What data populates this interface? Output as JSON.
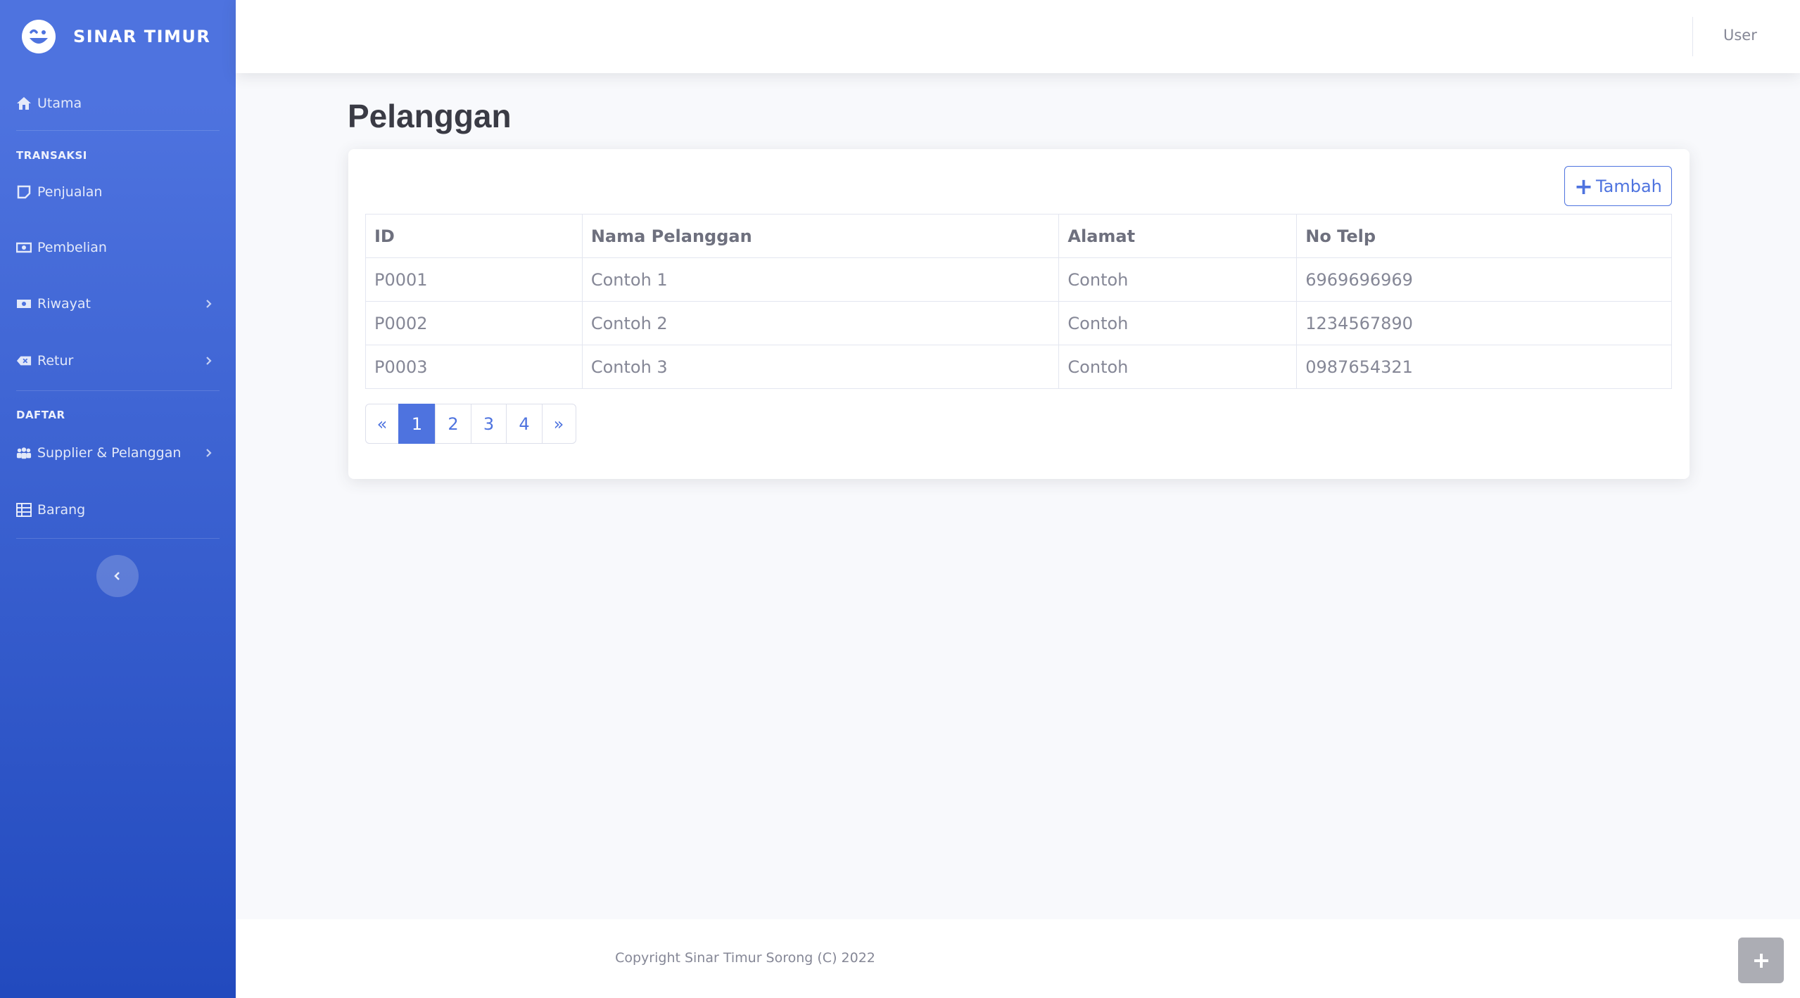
{
  "brand": {
    "name": "SINAR TIMUR",
    "logo_icon": "laugh-wink-icon"
  },
  "sidebar": {
    "items_top": [
      {
        "label": "Utama",
        "icon": "home-icon"
      }
    ],
    "section_transaksi": "TRANSAKSI",
    "transaksi_items": [
      {
        "label": "Penjualan",
        "icon": "sticky-note-icon"
      },
      {
        "label": "Pembelian",
        "icon": "money-bill-icon"
      },
      {
        "label": "Riwayat",
        "icon": "money-bill-icon",
        "has_submenu": true
      },
      {
        "label": "Retur",
        "icon": "backspace-icon",
        "has_submenu": true
      }
    ],
    "section_daftar": "DAFTAR",
    "daftar_items": [
      {
        "label": "Supplier & Pelanggan",
        "icon": "users-icon",
        "has_submenu": true
      },
      {
        "label": "Barang",
        "icon": "table-icon"
      }
    ],
    "toggle_icon": "chevron-left-icon"
  },
  "topbar": {
    "user_label": "User"
  },
  "page": {
    "title": "Pelanggan"
  },
  "toolbar": {
    "add_label": "Tambah"
  },
  "table": {
    "headers": [
      "ID",
      "Nama Pelanggan",
      "Alamat",
      "No Telp"
    ],
    "rows": [
      [
        "P0001",
        "Contoh 1",
        "Contoh",
        "6969696969"
      ],
      [
        "P0002",
        "Contoh 2",
        "Contoh",
        "1234567890"
      ],
      [
        "P0003",
        "Contoh 3",
        "Contoh",
        "0987654321"
      ]
    ]
  },
  "pagination": {
    "prev": "«",
    "pages": [
      "1",
      "2",
      "3",
      "4"
    ],
    "next": "»",
    "current": "1"
  },
  "footer": {
    "copyright": "Copyright Sinar Timur Sorong (C) 2022"
  },
  "colors": {
    "primary": "#4e73df",
    "sidebar_bottom": "#224abe",
    "text_muted": "#858796",
    "title": "#3a3b45"
  }
}
